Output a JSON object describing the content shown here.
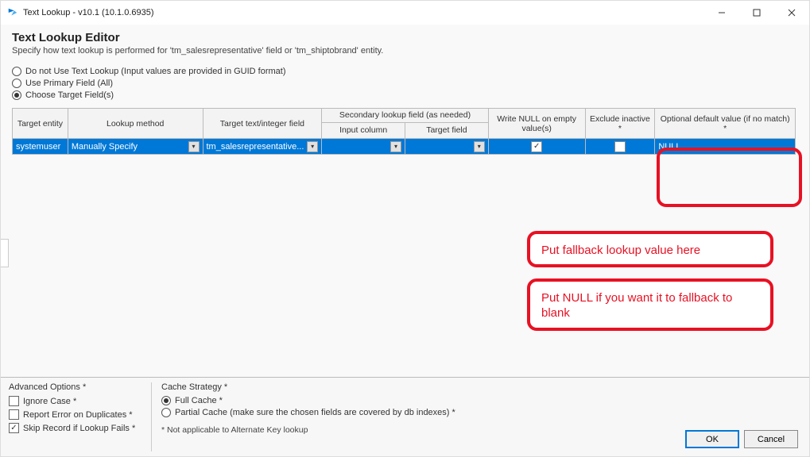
{
  "window": {
    "title": "Text Lookup - v10.1 (10.1.0.6935)"
  },
  "header": {
    "title": "Text Lookup Editor",
    "subtitle": "Specify how text lookup is performed for 'tm_salesrepresentative' field or 'tm_shiptobrand' entity."
  },
  "radios": {
    "opt1": "Do not Use Text Lookup (Input values are provided in GUID format)",
    "opt2": "Use Primary Field (All)",
    "opt3": "Choose Target Field(s)"
  },
  "grid": {
    "headers": {
      "entity": "Target entity",
      "method": "Lookup method",
      "target": "Target text/integer field",
      "secondary": "Secondary lookup field (as needed)",
      "input_col": "Input column",
      "target_field": "Target field",
      "writenull": "Write NULL on empty value(s)",
      "exclude": "Exclude inactive *",
      "default": "Optional default value (if no match) *"
    },
    "row": {
      "entity": "systemuser",
      "method": "Manually Specify",
      "target": "tm_salesrepresentative...",
      "writenull_checked": "✓",
      "exclude_checked": "",
      "default": "NULL"
    }
  },
  "annotations": {
    "a1": "Put fallback lookup value here",
    "a2": "Put NULL if you want it to fallback to blank"
  },
  "advanced": {
    "label": "Advanced Options *",
    "ignore_case": "Ignore Case *",
    "report_dup": "Report Error on Duplicates *",
    "skip_record": "Skip Record if Lookup Fails *"
  },
  "cache": {
    "label": "Cache Strategy *",
    "full": "Full Cache *",
    "partial": "Partial Cache (make sure the chosen fields are covered by db indexes) *",
    "footnote": "* Not applicable to Alternate Key lookup"
  },
  "buttons": {
    "ok": "OK",
    "cancel": "Cancel"
  }
}
